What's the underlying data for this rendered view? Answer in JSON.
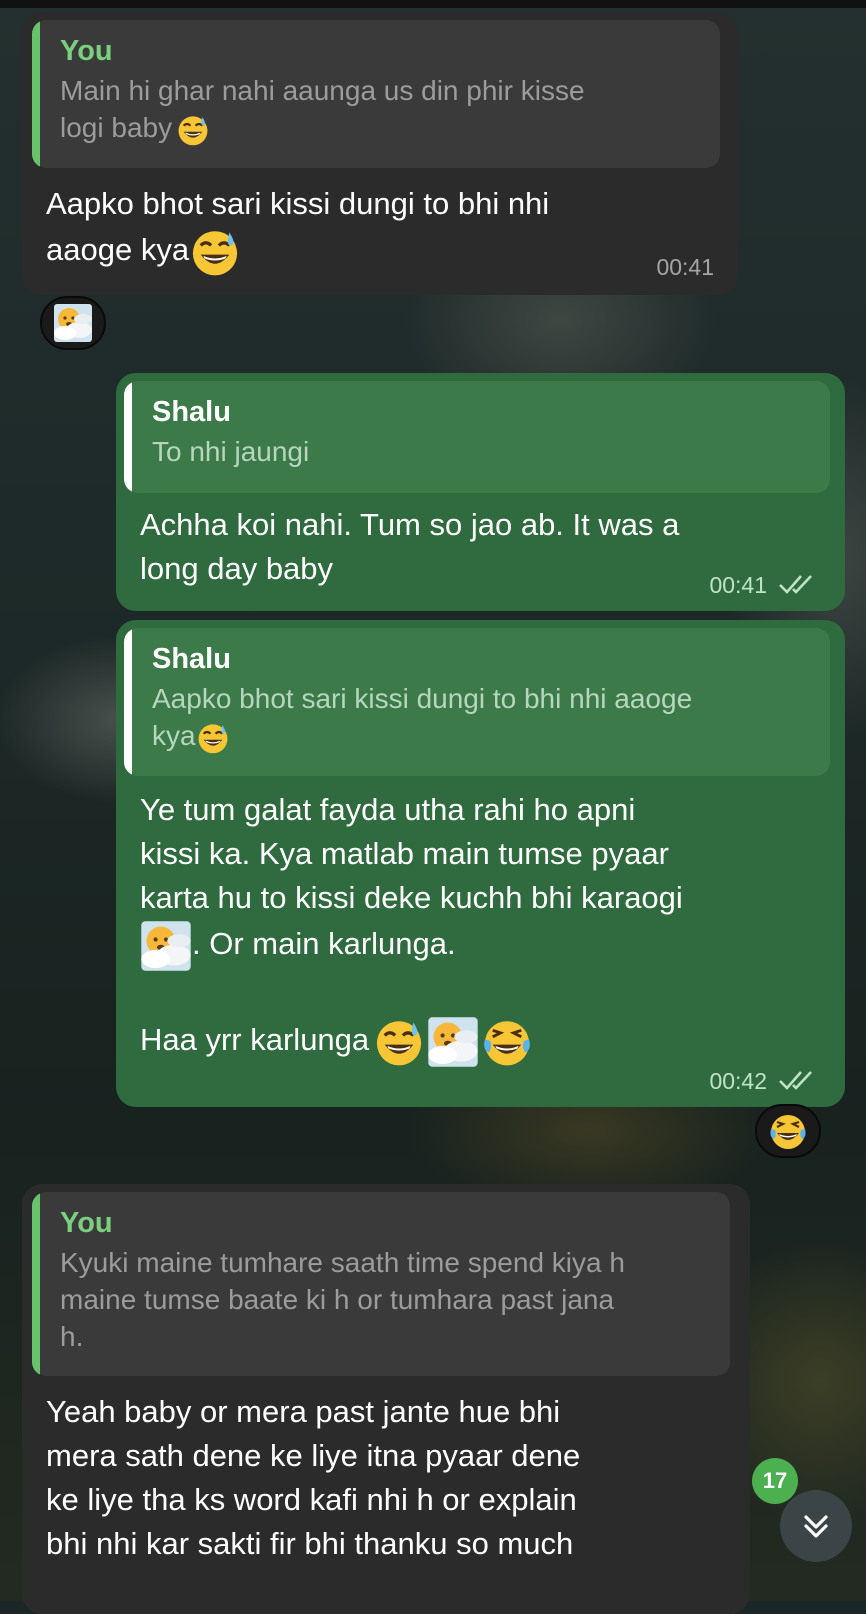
{
  "messages": [
    {
      "reply_author": "You",
      "reply_line1": "Main hi ghar nahi aaunga us din phir kisse",
      "reply_line2": "logi baby",
      "line1": "Aapko bhot sari kissi dungi to bhi nhi",
      "line2": "aaoge kya",
      "time": "00:41",
      "reaction": "fog-cloud-emoji"
    },
    {
      "reply_author": "Shalu",
      "reply_line1": "To nhi jaungi",
      "line1": "Achha koi nahi. Tum so jao ab. It was a",
      "line2": "long day baby",
      "time": "00:41",
      "status": "read"
    },
    {
      "reply_author": "Shalu",
      "reply_line1": "Aapko bhot sari kissi dungi to bhi nhi aaoge",
      "reply_line2": "kya",
      "line1": "Ye tum galat fayda utha rahi ho apni",
      "line2": "kissi ka. Kya matlab main tumse pyaar",
      "line3": "karta hu to kissi deke kuchh bhi karaogi",
      "line4": ". Or main karlunga.",
      "line5": "Haa yrr karlunga",
      "time": "00:42",
      "status": "read",
      "reaction": "laughing-tears-emoji"
    },
    {
      "reply_author": "You",
      "reply_line1": "Kyuki maine tumhare saath time spend kiya h",
      "reply_line2": "maine tumse baate ki h or tumhara past jana",
      "reply_line3": "h.",
      "line1": "Yeah baby or mera past jante hue bhi",
      "line2": "mera sath dene ke liye itna pyaar dene",
      "line3": "ke liye tha ks word kafi nhi h or explain",
      "line4": "bhi nhi kar sakti fir bhi thanku so much"
    }
  ],
  "unread_count": "17",
  "colors": {
    "incoming_bubble": "#2b2b2b",
    "outgoing_bubble": "#2f6b3e",
    "reply_accent_green": "#7bd07f",
    "badge": "#4caf50"
  },
  "icons": [
    "sweat-smile-emoji",
    "fog-cloud-emoji",
    "laughing-tears-emoji",
    "double-check-icon",
    "chevrons-down-icon"
  ]
}
